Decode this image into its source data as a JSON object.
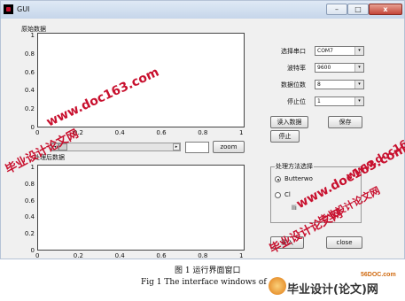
{
  "window": {
    "title": "GUI",
    "min_btn": "–",
    "max_btn": "□",
    "close_btn": "x"
  },
  "top_panel": {
    "label": "原始数据",
    "y_ticks": [
      "1",
      "0.8",
      "0.6",
      "0.4",
      "0.2",
      "0"
    ],
    "x_ticks": [
      "0",
      "0.2",
      "0.4",
      "0.6",
      "0.8",
      "1"
    ]
  },
  "bottom_panel": {
    "label": "处理后数据",
    "y_ticks": [
      "1",
      "0.8",
      "0.6",
      "0.4",
      "0.2",
      "0"
    ],
    "x_ticks": [
      "0",
      "0.2",
      "0.4",
      "0.6",
      "0.8",
      "1"
    ]
  },
  "slider": {
    "left_arrow": "◂",
    "right_arrow": "▸"
  },
  "zoom": {
    "label": "zoom",
    "value": ""
  },
  "serial": {
    "port_label": "选择串口",
    "port_value": "COM7",
    "baud_label": "波特率",
    "baud_value": "9600",
    "databits_label": "数据位数",
    "databits_value": "8",
    "stopbits_label": "停止位",
    "stopbits_value": "1",
    "dropdown_arrow": "▾"
  },
  "buttons": {
    "read": "读入数据",
    "save": "保存",
    "stop": "停止",
    "load": "载入",
    "close": "close"
  },
  "method_group": {
    "title": "处理方法选择",
    "options": [
      {
        "label": "Butterwo",
        "selected": true
      },
      {
        "label": "Cl",
        "selected": false
      },
      {
        "label": "lli",
        "selected": false
      }
    ]
  },
  "watermarks": {
    "a": "www.doc163.com",
    "b": "毕业设计论文网",
    "c": "www.doc163.com",
    "d": "毕业设计论文网",
    "e": "毕业设计论文网",
    "f": "www.doc163.c"
  },
  "footer": {
    "caption_cn": "图 1  运行界面窗口",
    "caption_en": "Fig 1 The interface windows of",
    "logo_site": "56DOC.com",
    "logo_text": "毕业设计(论文)网"
  }
}
